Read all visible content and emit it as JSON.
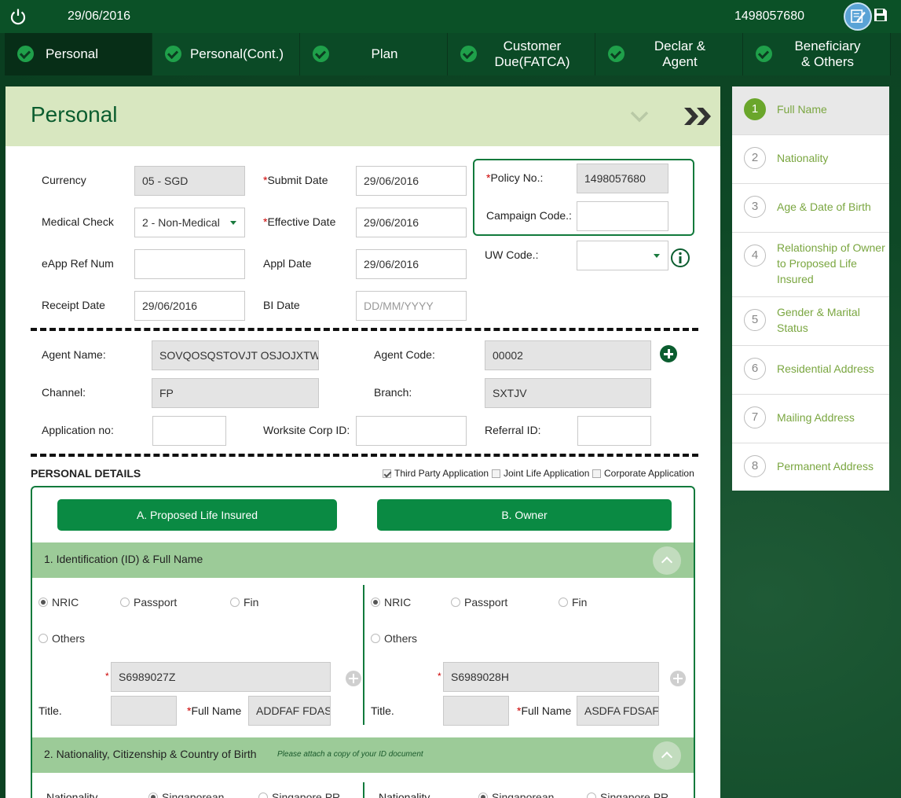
{
  "topbar": {
    "date": "29/06/2016",
    "policy_number": "1498057680"
  },
  "tabs": [
    {
      "label": "Personal"
    },
    {
      "label": "Personal(Cont.)"
    },
    {
      "label": "Plan"
    },
    {
      "label": "Customer Due(FATCA)"
    },
    {
      "label": "Declar & Agent"
    },
    {
      "label": "Beneficiary & Others"
    }
  ],
  "main": {
    "title": "Personal",
    "currency": {
      "label": "Currency",
      "value": "05 - SGD"
    },
    "medical_check": {
      "label": "Medical Check",
      "value": "2 - Non-Medical"
    },
    "eapp_ref": {
      "label": "eApp Ref Num",
      "value": ""
    },
    "receipt_date": {
      "label": "Receipt Date",
      "value": "29/06/2016"
    },
    "submit_date": {
      "label": "Submit Date",
      "value": "29/06/2016"
    },
    "effective_date": {
      "label": "Effective Date",
      "value": "29/06/2016"
    },
    "appl_date": {
      "label": "Appl Date",
      "value": "29/06/2016"
    },
    "bi_date": {
      "label": "BI Date",
      "placeholder": "DD/MM/YYYY"
    },
    "policy_no": {
      "label": "Policy No.:",
      "value": "1498057680"
    },
    "campaign_code": {
      "label": "Campaign Code.:",
      "value": ""
    },
    "uw_code": {
      "label": "UW Code.:",
      "value": ""
    },
    "agent_name": {
      "label": "Agent Name:",
      "value": "SOVQOSQSTOVJT OSJOJXTWW"
    },
    "agent_code": {
      "label": "Agent Code:",
      "value": "00002"
    },
    "channel": {
      "label": "Channel:",
      "value": "FP"
    },
    "branch": {
      "label": "Branch:",
      "value": "SXTJV"
    },
    "application_no": {
      "label": "Application no:",
      "value": ""
    },
    "worksite_corp_id": {
      "label": "Worksite Corp ID:",
      "value": ""
    },
    "referral_id": {
      "label": "Referral ID:",
      "value": ""
    }
  },
  "personal_details": {
    "title": "PERSONAL DETAILS",
    "options": [
      {
        "label": "Third Party Application",
        "checked": true
      },
      {
        "label": "Joint Life Application",
        "checked": false
      },
      {
        "label": "Corporate Application",
        "checked": false
      }
    ],
    "btn_life_insured": "A.  Proposed Life Insured",
    "btn_owner": "B. Owner",
    "section1_title": "1. Identification (ID) & Full Name",
    "id_types": [
      "NRIC",
      "Passport",
      "Fin",
      "Others"
    ],
    "left": {
      "id_value": "S6989027Z",
      "title_label": "Title.",
      "title_value": "",
      "full_name_label": "Full Name",
      "full_name_value": "ADDFAF FDASF"
    },
    "right": {
      "id_value": "S6989028H",
      "title_label": "Title.",
      "title_value": "",
      "full_name_label": "Full Name",
      "full_name_value": "ASDFA FDSAFS"
    },
    "section2_title": "2. Nationality, Citizenship & Country of Birth",
    "section2_note": "Please attach a copy of your ID document",
    "nationality_label": "Nationality",
    "nationality_options": [
      "Singaporean",
      "Singapore PR"
    ]
  },
  "steps": [
    {
      "num": "1",
      "label": "Full Name"
    },
    {
      "num": "2",
      "label": "Nationality"
    },
    {
      "num": "3",
      "label": "Age & Date of Birth"
    },
    {
      "num": "4",
      "label": "Relationship of Owner to Proposed Life Insured"
    },
    {
      "num": "5",
      "label": "Gender & Marital Status"
    },
    {
      "num": "6",
      "label": "Residential Address"
    },
    {
      "num": "7",
      "label": "Mailing Address"
    },
    {
      "num": "8",
      "label": "Permanent Address"
    }
  ],
  "colors": {
    "brand_dark": "#0b5127",
    "accent_green": "#0a8a43",
    "step_active": "#6aa62b",
    "section_band": "#9ccb98"
  }
}
